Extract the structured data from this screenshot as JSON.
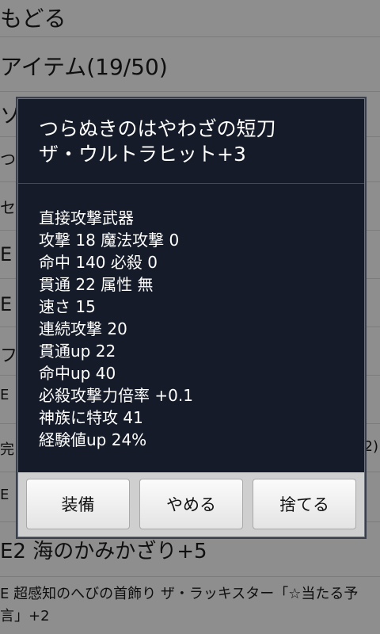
{
  "background": {
    "rows": [
      {
        "text": "もどる"
      },
      {
        "text": "アイテム(19/50)"
      },
      {
        "text": "ソ"
      },
      {
        "text": "つ"
      },
      {
        "text": "セ"
      },
      {
        "text": "E"
      },
      {
        "text": "E"
      },
      {
        "text": "フ"
      },
      {
        "text": "E"
      },
      {
        "text": "完"
      },
      {
        "text": "E"
      },
      {
        "text": "E2 海のかみかざり+5"
      },
      {
        "text": "E 超感知のへびの首飾り ザ・ラッキスター「☆当たる予言」+2"
      }
    ],
    "partial_right": "2)"
  },
  "dialog": {
    "title_line1": "つらぬきのはやわざの短刀",
    "title_line2": "ザ・ウルトラヒット+3",
    "stats": [
      "直接攻撃武器",
      "攻撃 18 魔法攻撃 0",
      "命中 140 必殺 0",
      "貫通 22 属性 無",
      "速さ 15",
      "連続攻撃 20",
      "貫通up 22",
      "命中up 40",
      "必殺攻撃力倍率 +0.1",
      "神族に特攻 41",
      "経験値up 24%"
    ],
    "buttons": {
      "equip": "装備",
      "cancel": "やめる",
      "discard": "捨てる"
    }
  }
}
